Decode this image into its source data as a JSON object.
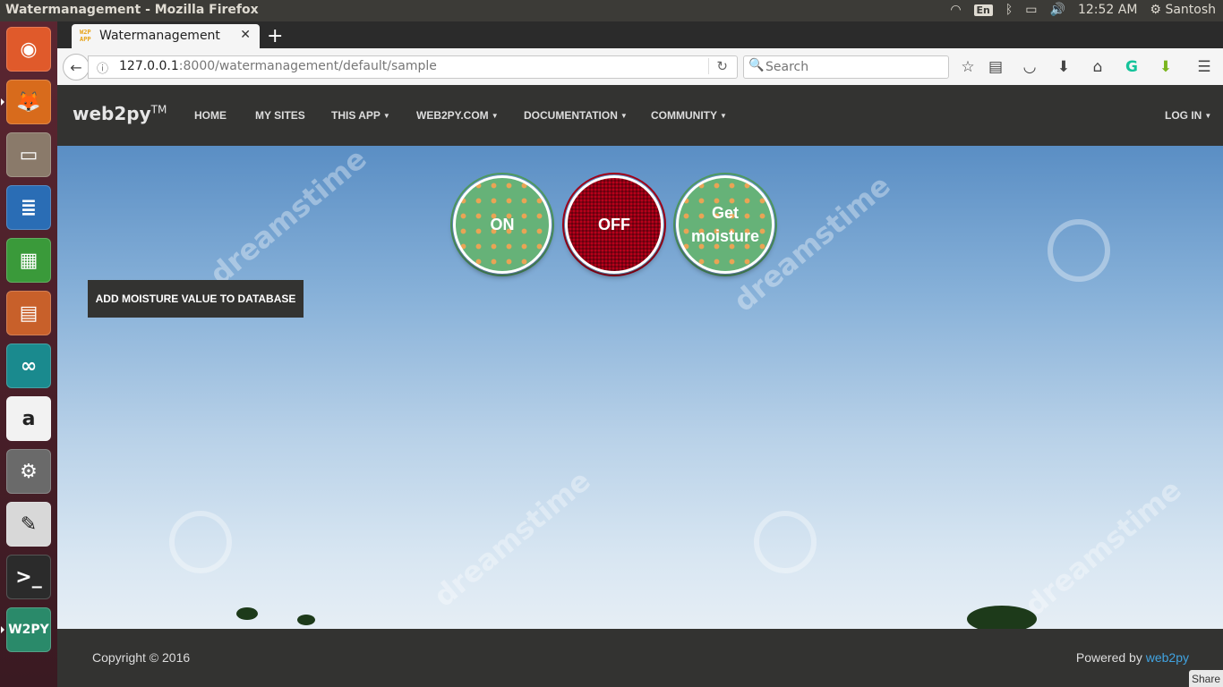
{
  "os": {
    "window_title": "Watermanagement - Mozilla Firefox",
    "tray": {
      "keyboard": "En",
      "time": "12:52 AM",
      "user": "Santosh"
    },
    "launcher": [
      {
        "name": "ubuntu-dash-icon",
        "glyph": "◉",
        "color": "#e05a2b"
      },
      {
        "name": "firefox-icon",
        "glyph": "🦊",
        "color": "#d86b1c"
      },
      {
        "name": "files-icon",
        "glyph": "▭",
        "color": "#8a7a6a"
      },
      {
        "name": "writer-icon",
        "glyph": "≣",
        "color": "#2a6db5"
      },
      {
        "name": "calc-icon",
        "glyph": "▦",
        "color": "#3a9a3a"
      },
      {
        "name": "impress-icon",
        "glyph": "▤",
        "color": "#c8602a"
      },
      {
        "name": "arduino-icon",
        "glyph": "∞",
        "color": "#1a8a8e"
      },
      {
        "name": "amazon-icon",
        "glyph": "a",
        "color": "#f2f2f2"
      },
      {
        "name": "system-settings-icon",
        "glyph": "⚙",
        "color": "#6a6a6a"
      },
      {
        "name": "text-editor-icon",
        "glyph": "✎",
        "color": "#d8d8d8"
      },
      {
        "name": "terminal-icon",
        "glyph": ">_",
        "color": "#2b2b2b"
      },
      {
        "name": "web2py-icon",
        "glyph": "W2PY",
        "color": "#2a8a6a"
      }
    ]
  },
  "browser": {
    "tab_title": "Watermanagement",
    "url_host": "127.0.0.1",
    "url_path": ":8000/watermanagement/default/sample",
    "search_placeholder": "Search"
  },
  "site": {
    "brand": "web2py",
    "brand_tm": "TM",
    "nav": {
      "home": "HOME",
      "my_sites": "MY SITES",
      "this_app": "THIS APP",
      "web2py_com": "WEB2PY.COM",
      "documentation": "DOCUMENTATION",
      "community": "COMMUNITY",
      "login": "LOG IN"
    },
    "buttons": {
      "on": "ON",
      "off": "OFF",
      "get_moisture": "Get moisture",
      "add_moisture": "ADD MOISTURE VALUE TO DATABASE"
    },
    "watermark_text": "dreamstime",
    "footer": {
      "copyright": "Copyright © 2016",
      "powered_prefix": "Powered by ",
      "powered_link": "web2py"
    },
    "share": "Share"
  }
}
